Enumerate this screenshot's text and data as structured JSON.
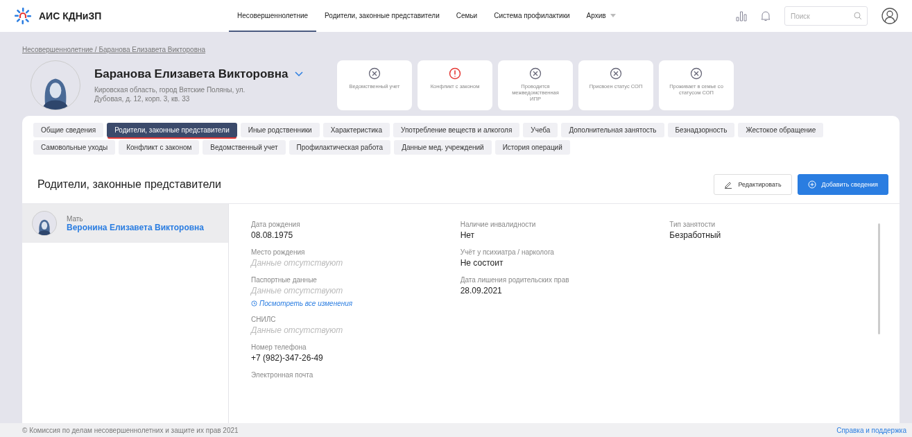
{
  "app": {
    "title": "АИС КДНиЗП"
  },
  "nav": [
    {
      "label": "Несовершеннолетние",
      "selected": true,
      "dropdown": false
    },
    {
      "label": "Родители, законные представители",
      "selected": false,
      "dropdown": false
    },
    {
      "label": "Семьи",
      "selected": false,
      "dropdown": false
    },
    {
      "label": "Система профилактики",
      "selected": false,
      "dropdown": false
    },
    {
      "label": "Архив",
      "selected": false,
      "dropdown": true
    }
  ],
  "search": {
    "placeholder": "Поиск"
  },
  "breadcrumb": "Несовершеннолетние / Баранова Елизавета Викторовна",
  "person": {
    "name": "Баранова Елизавета Викторовна",
    "address": "Кировская область, город Вятские Поляны, ул. Дубовая, д. 12, корп. 3, кв. 33"
  },
  "status_cards": [
    {
      "kind": "inactive",
      "label": "Ведомственный учет"
    },
    {
      "kind": "alert",
      "label": "Конфликт с законом"
    },
    {
      "kind": "inactive",
      "label": "Проводится межведомственная ИПР"
    },
    {
      "kind": "inactive",
      "label": "Присвоен статус СОП"
    },
    {
      "kind": "inactive",
      "label": "Проживает в семье со статусом СОП"
    }
  ],
  "tabs": [
    [
      {
        "label": "Общие сведения",
        "selected": false
      },
      {
        "label": "Родители, законные представители",
        "selected": true
      },
      {
        "label": "Иные родственники",
        "selected": false
      },
      {
        "label": "Характеристика",
        "selected": false
      },
      {
        "label": "Употребление веществ и алкоголя",
        "selected": false
      },
      {
        "label": "Учеба",
        "selected": false
      },
      {
        "label": "Дополнительная занятость",
        "selected": false
      },
      {
        "label": "Безнадзорность",
        "selected": false
      },
      {
        "label": "Жестокое обращение",
        "selected": false
      }
    ],
    [
      {
        "label": "Самовольные уходы",
        "selected": false
      },
      {
        "label": "Конфликт с законом",
        "selected": false
      },
      {
        "label": "Ведомственный учет",
        "selected": false
      },
      {
        "label": "Профилактическая работа",
        "selected": false
      },
      {
        "label": "Данные мед. учреждений",
        "selected": false
      },
      {
        "label": "История операций",
        "selected": false
      }
    ]
  ],
  "section": {
    "title": "Родители, законные представители",
    "buttons": [
      {
        "kind": "secondary",
        "label": "Редактировать"
      },
      {
        "kind": "primary",
        "label": "Добавить сведения"
      }
    ]
  },
  "parents": [
    {
      "role": "Мать",
      "name": "Веронина Елизавета Викторовна",
      "selected": true
    }
  ],
  "details": [
    [
      {
        "label": "Дата рождения",
        "value": "08.08.1975",
        "missing": false
      },
      {
        "label": "Место рождения",
        "value": "Данные отсутствуют",
        "missing": true
      },
      {
        "label": "Паспортные данные",
        "value": "Данные отсутствуют",
        "missing": true,
        "link": "Посмотреть все изменения"
      },
      {
        "label": "СНИЛС",
        "value": "Данные отсутствуют",
        "missing": true
      },
      {
        "label": "Номер телефона",
        "value": "+7 (982)-347-26-49",
        "missing": false
      },
      {
        "label": "Электронная почта"
      }
    ],
    [
      {
        "label": "Наличие инвалидности",
        "value": "Нет",
        "missing": false
      },
      {
        "label": "Учёт у психиатра / нарколога",
        "value": "Не состоит",
        "missing": false
      },
      {
        "label": "Дата лишения родительских прав",
        "value": "28.09.2021",
        "missing": false
      }
    ],
    [
      {
        "label": "Тип занятости",
        "value": "Безработный",
        "missing": false
      }
    ]
  ],
  "footer": {
    "copyright": "© Комиссия по делам несовершеннолетних и защите их прав 2021",
    "link": "Справка и поддержка"
  }
}
